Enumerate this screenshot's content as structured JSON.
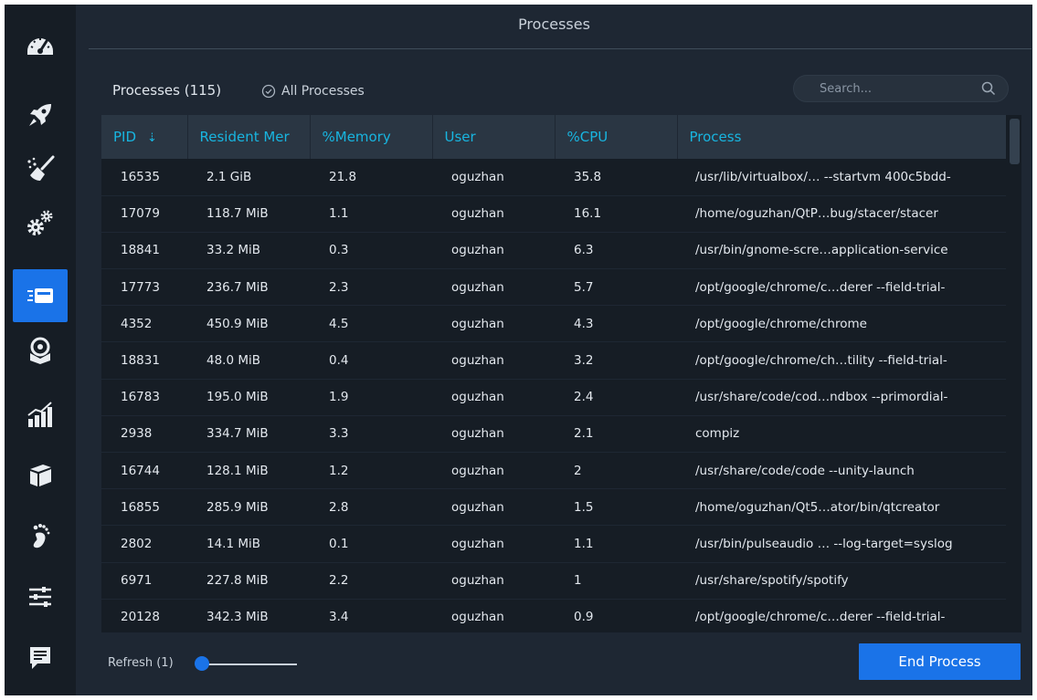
{
  "window": {
    "title": "Processes"
  },
  "sidebar": {
    "items": [
      {
        "name": "dashboard",
        "icon": "speedometer-icon",
        "active": false
      },
      {
        "name": "startup-apps",
        "icon": "rocket-icon",
        "active": false
      },
      {
        "name": "system-cleaner",
        "icon": "broom-icon",
        "active": false
      },
      {
        "name": "services",
        "icon": "gears-icon",
        "active": false
      },
      {
        "name": "processes",
        "icon": "processes-icon",
        "active": true
      },
      {
        "name": "uninstaller",
        "icon": "package-icon",
        "active": false
      },
      {
        "name": "resources",
        "icon": "bar-chart-icon",
        "active": false
      },
      {
        "name": "apt-repository",
        "icon": "box-icon",
        "active": false
      },
      {
        "name": "gnome-settings",
        "icon": "footprint-icon",
        "active": false
      },
      {
        "name": "settings",
        "icon": "sliders-icon",
        "active": false
      },
      {
        "name": "feedback",
        "icon": "message-icon",
        "active": false
      }
    ]
  },
  "toolbar": {
    "process_count": "Processes (115)",
    "all_processes_label": "All Processes",
    "search_placeholder": "Search..."
  },
  "table": {
    "columns": [
      "PID",
      "Resident Mer",
      "%Memory",
      "User",
      "%CPU",
      "Process"
    ],
    "rows": [
      [
        "16535",
        "2.1 GiB",
        "21.8",
        "oguzhan",
        "35.8",
        "/usr/lib/virtualbox/… --startvm 400c5bdd-"
      ],
      [
        "17079",
        "118.7 MiB",
        "1.1",
        "oguzhan",
        "16.1",
        "/home/oguzhan/QtP…bug/stacer/stacer"
      ],
      [
        "18841",
        "33.2 MiB",
        "0.3",
        "oguzhan",
        "6.3",
        "/usr/bin/gnome-scre…application-service"
      ],
      [
        "17773",
        "236.7 MiB",
        "2.3",
        "oguzhan",
        "5.7",
        "/opt/google/chrome/c…derer --field-trial-"
      ],
      [
        "4352",
        "450.9 MiB",
        "4.5",
        "oguzhan",
        "4.3",
        "/opt/google/chrome/chrome"
      ],
      [
        "18831",
        "48.0 MiB",
        "0.4",
        "oguzhan",
        "3.2",
        "/opt/google/chrome/ch…tility --field-trial-"
      ],
      [
        "16783",
        "195.0 MiB",
        "1.9",
        "oguzhan",
        "2.4",
        "/usr/share/code/cod…ndbox --primordial-"
      ],
      [
        "2938",
        "334.7 MiB",
        "3.3",
        "oguzhan",
        "2.1",
        "compiz"
      ],
      [
        "16744",
        "128.1 MiB",
        "1.2",
        "oguzhan",
        "2",
        "/usr/share/code/code --unity-launch"
      ],
      [
        "16855",
        "285.9 MiB",
        "2.8",
        "oguzhan",
        "1.5",
        "/home/oguzhan/Qt5…ator/bin/qtcreator"
      ],
      [
        "2802",
        "14.1 MiB",
        "0.1",
        "oguzhan",
        "1.1",
        "/usr/bin/pulseaudio … --log-target=syslog"
      ],
      [
        "6971",
        "227.8 MiB",
        "2.2",
        "oguzhan",
        "1",
        "/usr/share/spotify/spotify"
      ],
      [
        "20128",
        "342.3 MiB",
        "3.4",
        "oguzhan",
        "0.9",
        "/opt/google/chrome/c…derer --field-trial-"
      ]
    ]
  },
  "footer": {
    "refresh_label": "Refresh (1)",
    "refresh_value": 1,
    "end_process_label": "End Process"
  },
  "colors": {
    "accent": "#1a73e8",
    "header_text": "#18b5e0",
    "background": "#1e2733",
    "sidebar": "#161d25"
  }
}
